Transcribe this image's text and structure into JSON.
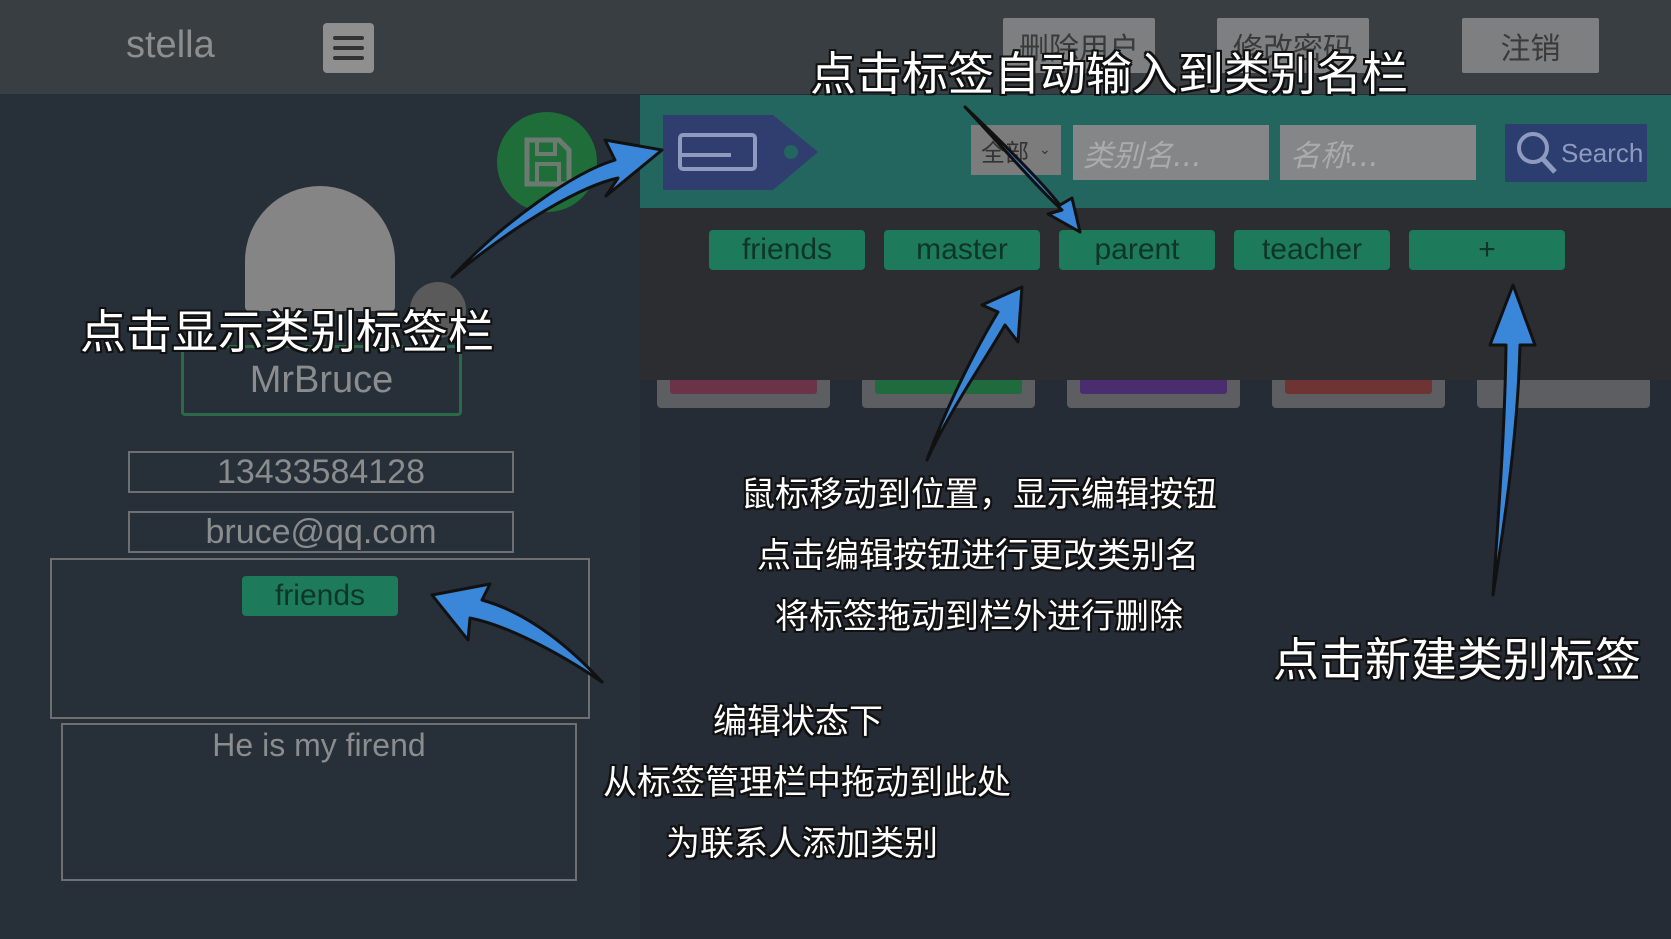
{
  "header": {
    "brand": "stella",
    "buttons": [
      "删除用户",
      "修改密码",
      "注销"
    ]
  },
  "contact": {
    "name": "MrBruce",
    "phone": "13433584128",
    "email": "bruce@qq.com",
    "tags": [
      "friends"
    ],
    "note": "He is my firend"
  },
  "toolbar": {
    "select_value": "全部",
    "category_placeholder": "类别名...",
    "name_placeholder": "名称...",
    "search_label": "Search"
  },
  "tag_panel": {
    "tags": [
      "friends",
      "master",
      "parent",
      "teacher"
    ],
    "add_label": "+"
  },
  "annotations": {
    "tag_click": "点击标签自动输入到类别名栏",
    "show_bar": "点击显示类别标签栏",
    "hover_lines": [
      "鼠标移动到位置，显示编辑按钮",
      "点击编辑按钮进行更改类别名",
      "将标签拖动到栏外进行删除"
    ],
    "new_tag": "点击新建类别标签",
    "drag_lines": [
      "编辑状态下",
      "从标签管理栏中拖动到此处",
      "为联系人添加类别"
    ]
  },
  "colors": {
    "topbar": "#393e43",
    "toolbar": "#23665f",
    "tag_green": "#1d7b5b",
    "search_blue": "#2c3e6f",
    "arrow_blue": "#3a86d8"
  }
}
